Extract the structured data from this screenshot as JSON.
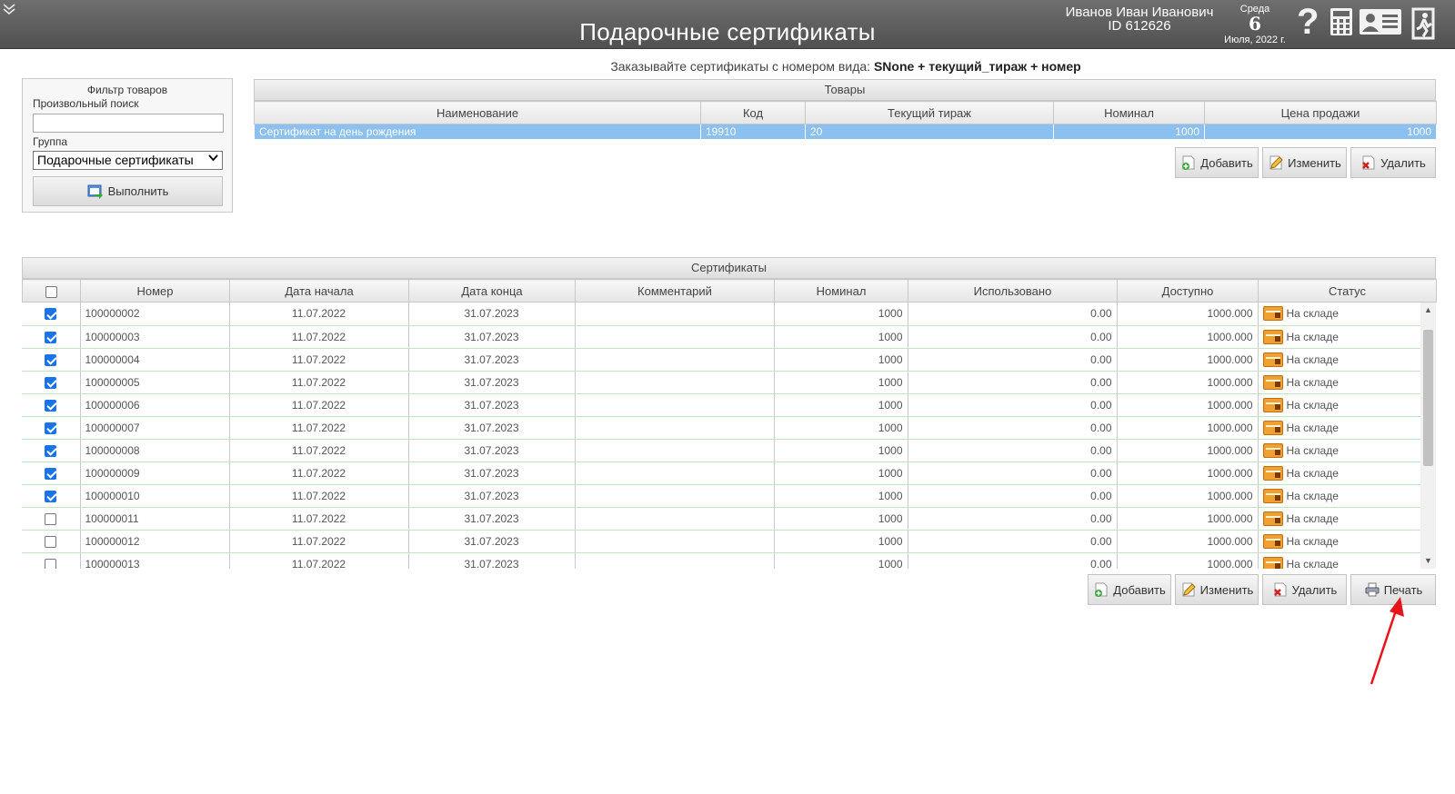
{
  "header": {
    "title": "Подарочные сертификаты",
    "user_name": "Иванов Иван Иванович",
    "user_id": "ID 612626",
    "day_of_week": "Среда",
    "day": "6",
    "month_year": "Июля, 2022 г.",
    "help_glyph": "?"
  },
  "filter": {
    "title": "Фильтр товаров",
    "search_label": "Произвольный поиск",
    "search_value": "",
    "group_label": "Группа",
    "group_value": "Подарочные сертификаты",
    "run_label": "Выполнить"
  },
  "note": {
    "prefix": "Заказывайте сертификаты с номером вида: ",
    "pattern": "SNone + текущий_тираж + номер"
  },
  "goods": {
    "caption": "Товары",
    "columns": [
      "Наименование",
      "Код",
      "Текущий тираж",
      "Номинал",
      "Цена продажи"
    ],
    "rows": [
      {
        "name": "Сертификат на день рождения",
        "code": "19910",
        "edition": "20",
        "nominal": "1000",
        "price": "1000"
      }
    ],
    "buttons": {
      "add": "Добавить",
      "edit": "Изменить",
      "delete": "Удалить"
    }
  },
  "certs": {
    "caption": "Сертификаты",
    "columns": [
      "Номер",
      "Дата начала",
      "Дата конца",
      "Комментарий",
      "Номинал",
      "Использовано",
      "Доступно",
      "Статус"
    ],
    "header_checked": false,
    "rows": [
      {
        "checked": true,
        "number": "100000002",
        "start": "11.07.2022",
        "end": "31.07.2023",
        "comment": "",
        "nominal": "1000",
        "used": "0.00",
        "available": "1000.000",
        "status": "На складе"
      },
      {
        "checked": true,
        "number": "100000003",
        "start": "11.07.2022",
        "end": "31.07.2023",
        "comment": "",
        "nominal": "1000",
        "used": "0.00",
        "available": "1000.000",
        "status": "На складе"
      },
      {
        "checked": true,
        "number": "100000004",
        "start": "11.07.2022",
        "end": "31.07.2023",
        "comment": "",
        "nominal": "1000",
        "used": "0.00",
        "available": "1000.000",
        "status": "На складе"
      },
      {
        "checked": true,
        "number": "100000005",
        "start": "11.07.2022",
        "end": "31.07.2023",
        "comment": "",
        "nominal": "1000",
        "used": "0.00",
        "available": "1000.000",
        "status": "На складе"
      },
      {
        "checked": true,
        "number": "100000006",
        "start": "11.07.2022",
        "end": "31.07.2023",
        "comment": "",
        "nominal": "1000",
        "used": "0.00",
        "available": "1000.000",
        "status": "На складе"
      },
      {
        "checked": true,
        "number": "100000007",
        "start": "11.07.2022",
        "end": "31.07.2023",
        "comment": "",
        "nominal": "1000",
        "used": "0.00",
        "available": "1000.000",
        "status": "На складе"
      },
      {
        "checked": true,
        "number": "100000008",
        "start": "11.07.2022",
        "end": "31.07.2023",
        "comment": "",
        "nominal": "1000",
        "used": "0.00",
        "available": "1000.000",
        "status": "На складе"
      },
      {
        "checked": true,
        "number": "100000009",
        "start": "11.07.2022",
        "end": "31.07.2023",
        "comment": "",
        "nominal": "1000",
        "used": "0.00",
        "available": "1000.000",
        "status": "На складе"
      },
      {
        "checked": true,
        "number": "100000010",
        "start": "11.07.2022",
        "end": "31.07.2023",
        "comment": "",
        "nominal": "1000",
        "used": "0.00",
        "available": "1000.000",
        "status": "На складе"
      },
      {
        "checked": false,
        "number": "100000011",
        "start": "11.07.2022",
        "end": "31.07.2023",
        "comment": "",
        "nominal": "1000",
        "used": "0.00",
        "available": "1000.000",
        "status": "На складе"
      },
      {
        "checked": false,
        "number": "100000012",
        "start": "11.07.2022",
        "end": "31.07.2023",
        "comment": "",
        "nominal": "1000",
        "used": "0.00",
        "available": "1000.000",
        "status": "На складе"
      },
      {
        "checked": false,
        "number": "100000013",
        "start": "11.07.2022",
        "end": "31.07.2023",
        "comment": "",
        "nominal": "1000",
        "used": "0.00",
        "available": "1000.000",
        "status": "На складе"
      }
    ],
    "buttons": {
      "add": "Добавить",
      "edit": "Изменить",
      "delete": "Удалить",
      "print": "Печать"
    }
  },
  "icons": {
    "collapse": "chevron-down-icon",
    "help": "help-icon",
    "calculator": "calculator-icon",
    "id_card": "id-card-icon",
    "exit": "exit-icon",
    "run": "run-icon",
    "add": "add-icon",
    "edit": "edit-icon",
    "delete": "delete-icon",
    "print": "printer-icon",
    "status": "warehouse-box-icon"
  },
  "colors": {
    "header_bg": "#5a5a5a",
    "selected_row": "#8cc0f0",
    "checkbox_on": "#1a73e8",
    "annotation_arrow": "#e8141c"
  }
}
